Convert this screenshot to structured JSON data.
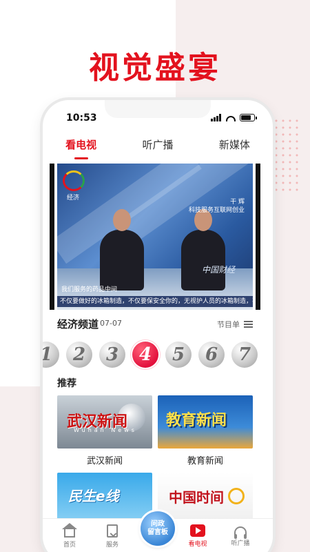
{
  "headline": "视觉盛宴",
  "status_bar": {
    "time": "10:53"
  },
  "top_tabs": [
    {
      "label": "看电视",
      "active": true
    },
    {
      "label": "听广播",
      "active": false
    },
    {
      "label": "新媒体",
      "active": false
    }
  ],
  "video": {
    "channel_logo_text": "经济",
    "side_label_line1": "干 辉",
    "side_label_line2": "科技服务互联网创业",
    "caption_line1": "我们服务的药品中间",
    "caption_line2": "不仅要做好的冰箱制造，不仅要保安全你的，无视护人员的冰箱制造，不合冰柱护学生不懂们",
    "watermark": "中国财经"
  },
  "channel_info": {
    "name": "经济频道",
    "date": "07-07",
    "schedule_label": "节目单"
  },
  "channels": [
    {
      "label": "1",
      "active": false
    },
    {
      "label": "2",
      "active": false
    },
    {
      "label": "3",
      "active": false
    },
    {
      "label": "4",
      "active": true
    },
    {
      "label": "5",
      "active": false
    },
    {
      "label": "6",
      "active": false
    },
    {
      "label": "7",
      "active": false
    }
  ],
  "recommend": {
    "title": "推荐",
    "items": [
      {
        "label": "武汉新闻",
        "thumb_text": "武汉新闻",
        "thumb_sub": "Wuhan News"
      },
      {
        "label": "教育新闻",
        "thumb_text": "教育新闻"
      },
      {
        "thumb_text": "民生e线"
      },
      {
        "thumb_text": "中国时间"
      }
    ]
  },
  "message_board": {
    "line1": "问政",
    "line2": "留言板"
  },
  "bottom_nav": [
    {
      "label": "首页",
      "icon": "home-icon",
      "active": false
    },
    {
      "label": "服务",
      "icon": "service-icon",
      "active": false
    },
    {
      "label": "看电视",
      "icon": "tv-icon",
      "active": true
    },
    {
      "label": "听广播",
      "icon": "radio-icon",
      "active": false
    }
  ],
  "colors": {
    "accent": "#e3121e",
    "background_tint": "#f6eeee"
  }
}
